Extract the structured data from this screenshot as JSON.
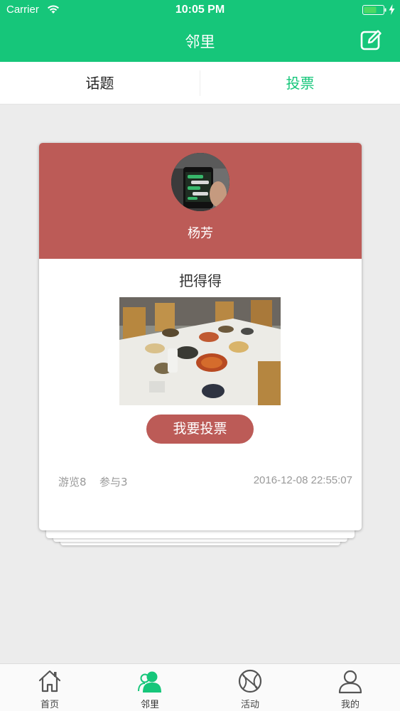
{
  "status_bar": {
    "carrier": "Carrier",
    "time": "10:05 PM",
    "battery_color": "#4cd964"
  },
  "nav": {
    "title": "邻里",
    "right_icon": "compose-icon"
  },
  "segments": {
    "left_label": "话题",
    "right_label": "投票",
    "active": "投票",
    "active_color": "#16c67a"
  },
  "vote_card": {
    "accent_color": "#bc5b57",
    "user_name": "杨芳",
    "title": "把得得",
    "vote_button_label": "我要投票",
    "views": "游览8",
    "participants": "参与3",
    "timestamp": "2016-12-08 22:55:07"
  },
  "tab_bar": {
    "items": [
      {
        "label": "首页",
        "icon": "home-icon"
      },
      {
        "label": "邻里",
        "icon": "neighbor-icon",
        "active": true
      },
      {
        "label": "活动",
        "icon": "ball-icon"
      },
      {
        "label": "我的",
        "icon": "profile-icon"
      }
    ],
    "active_color": "#16c67a"
  },
  "colors": {
    "brand": "#16c67a",
    "background": "#ececec"
  }
}
